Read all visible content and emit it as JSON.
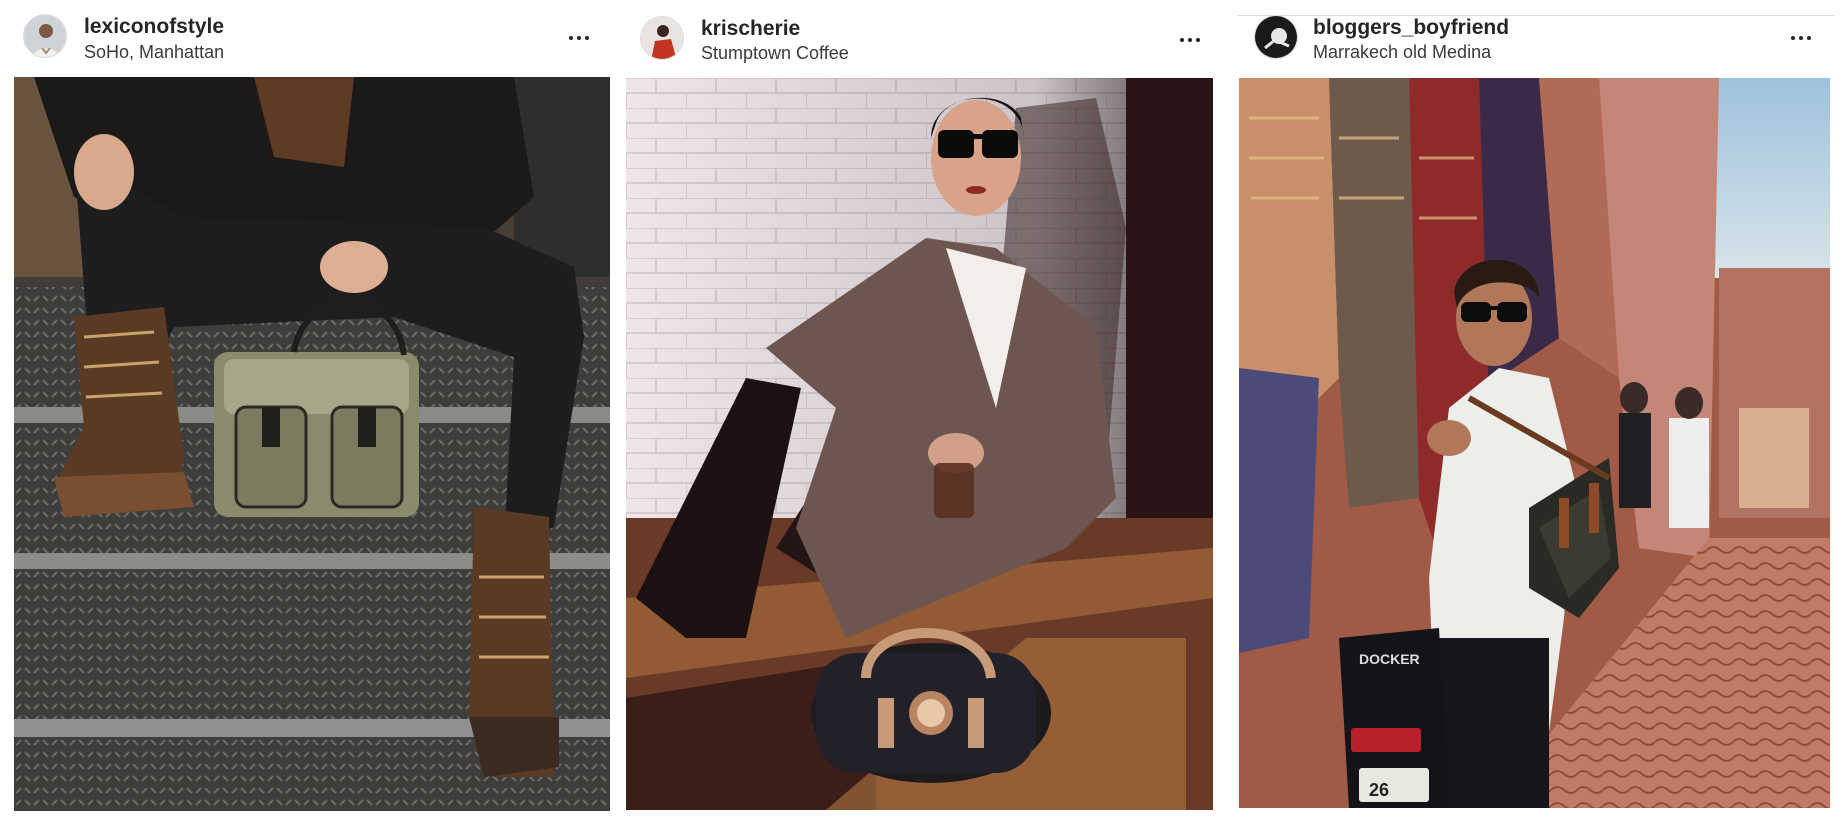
{
  "posts": [
    {
      "username": "lexiconofstyle",
      "location": "SoHo, Manhattan",
      "more_icon": "more-horizontal-icon",
      "photo_alt": "Person seated on steel diamond-plate steps in monogram combat boots holding an olive satchel"
    },
    {
      "username": "krischerie",
      "location": "Stumptown Coffee",
      "more_icon": "more-horizontal-icon",
      "photo_alt": "Woman in sunglasses and houndstooth blazer sitting against white brick wall with a duffle bag"
    },
    {
      "username": "bloggers_boyfriend",
      "location": "Marrakech old Medina",
      "more_icon": "more-horizontal-icon",
      "photo_alt": "Man in sunglasses and white henley with leather bag in a rug-lined Medina alley"
    }
  ],
  "colors": {
    "text": "#262626",
    "subtext": "#3a3a3a"
  }
}
